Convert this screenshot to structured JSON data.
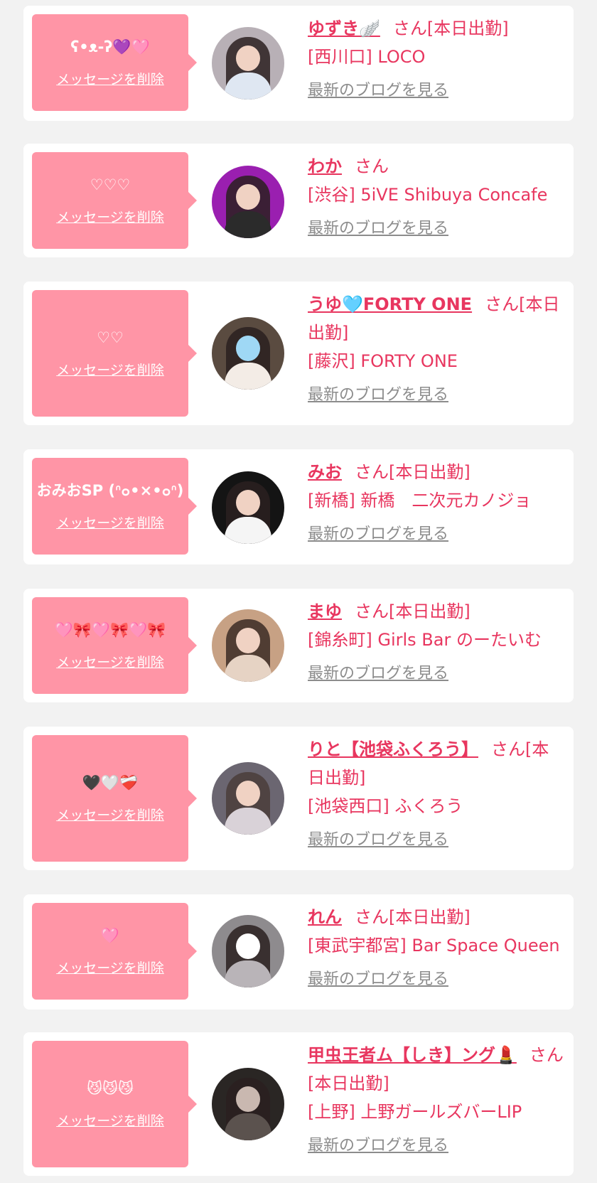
{
  "messages": [
    {
      "message": "ʕ•ᴥ-ʔ💜🩷",
      "delete_label": "メッセージを削除",
      "name": "ゆずき🪽",
      "suffix": "さん[本日出勤]",
      "shop": "[西川口] LOCO",
      "blog_link": "最新のブログを見る"
    },
    {
      "message": "♡♡♡",
      "delete_label": "メッセージを削除",
      "name": "わか",
      "suffix": "さん",
      "shop": "[渋谷] 5iVE Shibuya Concafe",
      "blog_link": "最新のブログを見る"
    },
    {
      "message": "♡♡",
      "delete_label": "メッセージを削除",
      "name": "うゆ🩵FORTY ONE",
      "suffix": "さん[本日出勤]",
      "shop": "[藤沢] FORTY ONE",
      "blog_link": "最新のブログを見る"
    },
    {
      "message": "おみおSP (ᐢ๐•×•๐ᐢ)",
      "delete_label": "メッセージを削除",
      "name": "みお",
      "suffix": "さん[本日出勤]",
      "shop": "[新橋] 新橋　二次元カノジョ",
      "blog_link": "最新のブログを見る"
    },
    {
      "message": "🩷🎀🩷🎀🩷🎀",
      "delete_label": "メッセージを削除",
      "name": "まゆ",
      "suffix": "さん[本日出勤]",
      "shop": "[錦糸町] Girls Bar のーたいむ",
      "blog_link": "最新のブログを見る"
    },
    {
      "message": "🖤🤍❤️‍🩹",
      "delete_label": "メッセージを削除",
      "name": "りと【池袋ふくろう】",
      "suffix": "さん[本日出勤]",
      "shop": "[池袋西口] ふくろう",
      "blog_link": "最新のブログを見る"
    },
    {
      "message": "🩷",
      "delete_label": "メッセージを削除",
      "name": "れん",
      "suffix": "さん[本日出勤]",
      "shop": "[東武宇都宮] Bar Space Queen",
      "blog_link": "最新のブログを見る"
    },
    {
      "message": "😼😼😼",
      "delete_label": "メッセージを削除",
      "name": "甲虫王者ム【しき】ング💄",
      "suffix": "さん[本日出勤]",
      "shop": "[上野] 上野ガールズバーLIP",
      "blog_link": "最新のブログを見る"
    }
  ],
  "colors": {
    "accent": "#e8365f",
    "bubble": "#ff95a6",
    "link_gray": "#8c8c8c",
    "page_bg": "#f2f2f2"
  }
}
